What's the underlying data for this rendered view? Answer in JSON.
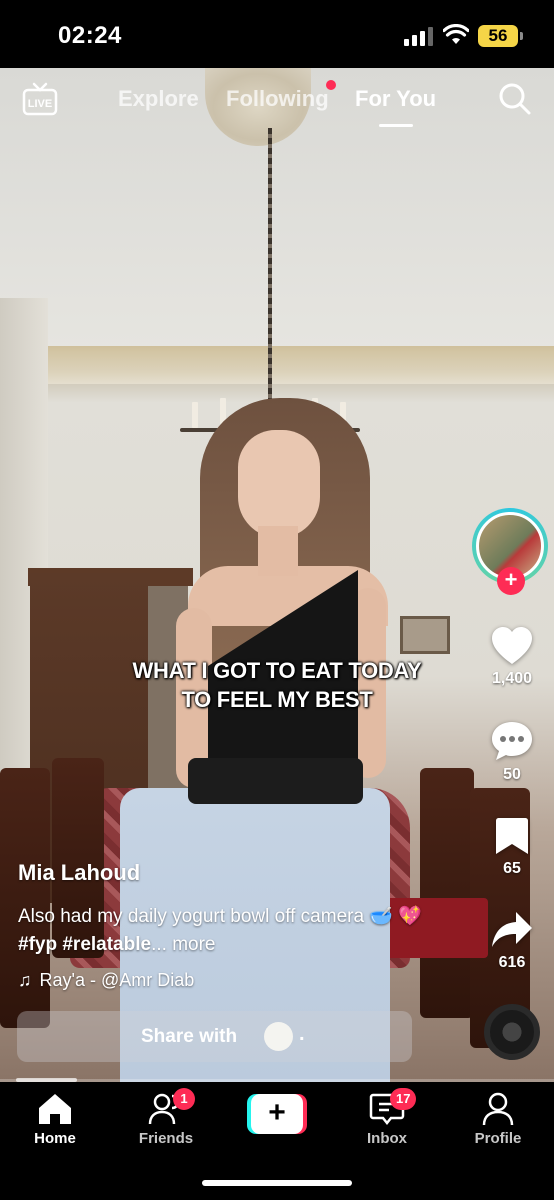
{
  "status_bar": {
    "time": "02:24",
    "battery": "56"
  },
  "top_nav": {
    "live_label": "LIVE",
    "tabs": [
      {
        "label": "Explore",
        "active": false
      },
      {
        "label": "Following",
        "active": false,
        "has_dot": true
      },
      {
        "label": "For You",
        "active": true
      }
    ]
  },
  "video": {
    "overlay_text_line1": "WHAT I GOT TO EAT TODAY",
    "overlay_text_line2": "TO FEEL MY BEST",
    "progress_fraction": 0.11
  },
  "author": {
    "username": "Mia Lahoud",
    "description_text": "Also had my daily yogurt bowl off camera",
    "emojis": [
      "🥣",
      "💖"
    ],
    "hashtags": [
      "#fyp",
      "#relatable"
    ],
    "more_label": "... more"
  },
  "sound": {
    "label": "Ray'a - @Amr Diab"
  },
  "actions": {
    "likes": "1,400",
    "comments": "50",
    "saves": "65",
    "shares": "616"
  },
  "share_bar": {
    "label": "Share with",
    "suffix": "."
  },
  "bottom_nav": {
    "items": [
      {
        "label": "Home",
        "active": true
      },
      {
        "label": "Friends",
        "badge": "1"
      },
      {
        "label": "Inbox",
        "badge": "17"
      },
      {
        "label": "Profile"
      }
    ]
  },
  "colors": {
    "accent": "#fe2c55",
    "cyan": "#25f4ee",
    "battery": "#f5d547"
  }
}
